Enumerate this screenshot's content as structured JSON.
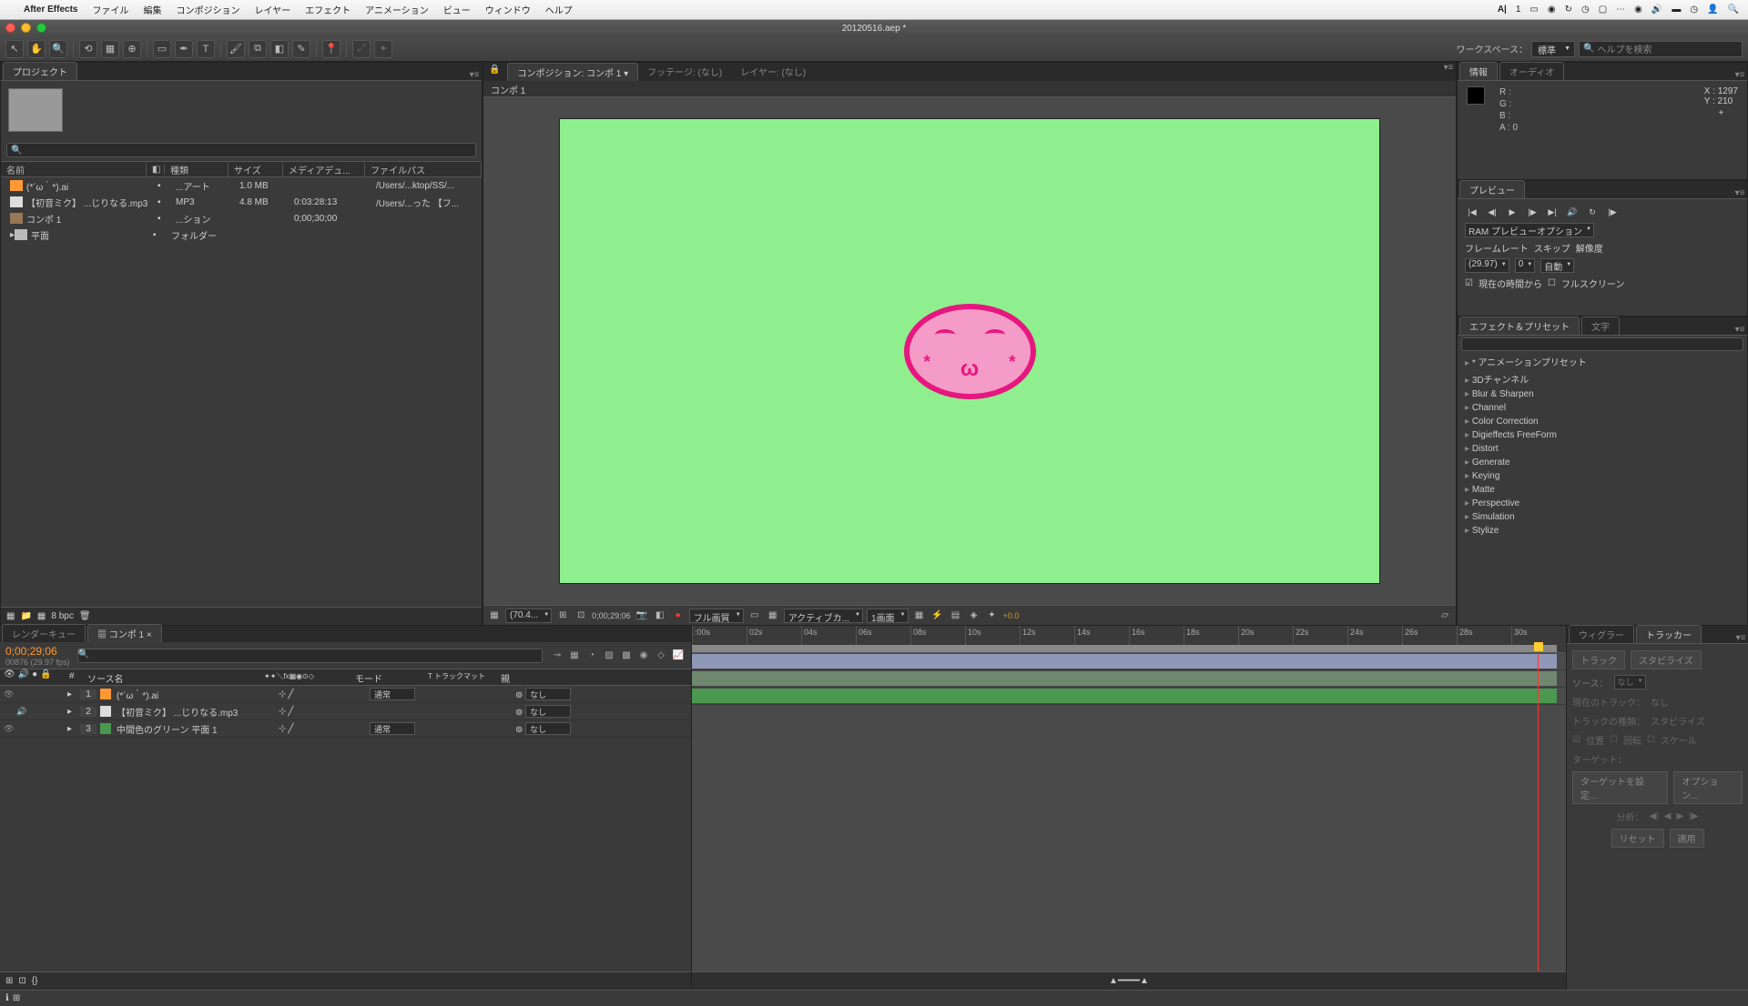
{
  "menubar": {
    "app": "After Effects",
    "items": [
      "ファイル",
      "編集",
      "コンポジション",
      "レイヤー",
      "エフェクト",
      "アニメーション",
      "ビュー",
      "ウィンドウ",
      "ヘルプ"
    ],
    "right_badge": "1"
  },
  "window_title": "20120516.aep *",
  "workspace": {
    "label": "ワークスペース：",
    "value": "標準"
  },
  "search_placeholder": "ヘルプを検索",
  "project": {
    "tab": "プロジェクト",
    "cols": {
      "name": "名前",
      "type": "種類",
      "size": "サイズ",
      "dur": "メディアデュ...",
      "path": "ファイルパス"
    },
    "items": [
      {
        "name": "(*´ω｀*).ai",
        "type": "...アート",
        "size": "1.0 MB",
        "dur": "",
        "path": "/Users/...ktop/SS/..."
      },
      {
        "name": "【初音ミク】 ...じりなる.mp3",
        "type": "MP3",
        "size": "4.8 MB",
        "dur": "0:03:28:13",
        "path": "/Users/...った 【フ..."
      },
      {
        "name": "コンポ 1",
        "type": "...ション",
        "size": "",
        "dur": "0;00;30;00",
        "path": ""
      },
      {
        "name": "平面",
        "type": "フォルダー",
        "size": "",
        "dur": "",
        "path": ""
      }
    ],
    "bpc": "8 bpc"
  },
  "comp": {
    "title": "コンポジション: コンポ 1",
    "footage": "フッテージ: (なし)",
    "layer": "レイヤー: (なし)",
    "sub": "コンポ 1",
    "footer": {
      "zoom": "(70.4...",
      "time": "0;00;29;06",
      "res": "フル画質",
      "view": "アクティブカ...",
      "grid": "1画面",
      "exp": "+0.0"
    }
  },
  "info": {
    "tab1": "情報",
    "tab2": "オーディオ",
    "r": "R :",
    "g": "G :",
    "b": "B :",
    "a": "A : 0",
    "x": "X : 1297",
    "y": "Y : 210"
  },
  "preview": {
    "tab": "プレビュー",
    "ram": "RAM プレビューオプション",
    "labels": {
      "fr": "フレームレート",
      "skip": "スキップ",
      "res": "解像度"
    },
    "fps": "(29.97)",
    "skip": "0",
    "res": "自動",
    "check1": "現在の時間から",
    "check2": "フルスクリーン"
  },
  "effects": {
    "tab1": "エフェクト＆プリセット",
    "tab2": "文字",
    "cats": [
      "* アニメーションプリセット",
      "3Dチャンネル",
      "Blur & Sharpen",
      "Channel",
      "Color Correction",
      "Digieffects FreeForm",
      "Distort",
      "Generate",
      "Keying",
      "Matte",
      "Perspective",
      "Simulation",
      "Stylize"
    ]
  },
  "timeline": {
    "tab_rq": "レンダーキュー",
    "tab_comp": "コンポ 1",
    "time": "0;00;29;06",
    "sub": "00876 (29.97 fps)",
    "col_src": "ソース名",
    "col_mode": "モード",
    "col_trk": "T トラックマット",
    "col_par": "親",
    "layers": [
      {
        "idx": "1",
        "name": "(*´ω｀*).ai",
        "mode": "通常",
        "parent": "なし",
        "color": "#ff9933"
      },
      {
        "idx": "2",
        "name": "【初音ミク】 ...じりなる.mp3",
        "mode": "",
        "parent": "なし",
        "color": "#66cccc"
      },
      {
        "idx": "3",
        "name": "中間色のグリーン 平面 1",
        "mode": "通常",
        "parent": "なし",
        "color": "#4a9850"
      }
    ],
    "ruler": [
      ":00s",
      "02s",
      "04s",
      "06s",
      "08s",
      "10s",
      "12s",
      "14s",
      "16s",
      "18s",
      "20s",
      "22s",
      "24s",
      "26s",
      "28s",
      "30s"
    ]
  },
  "tracker": {
    "tab1": "ウィグラー",
    "tab2": "トラッカー",
    "btn_track": "トラック",
    "btn_stab": "スタビライズ",
    "src_lbl": "ソース：",
    "src_val": "なし",
    "cur_track": "現在のトラック：",
    "cur_val": "なし",
    "track_type": "トラックの種類：",
    "type_val": "スタビライズ",
    "pos": "位置",
    "rot": "回転",
    "scale": "スケール",
    "target": "ターゲット：",
    "set_target": "ターゲットを設定...",
    "options": "オプション...",
    "analyze": "分析：",
    "reset": "リセット",
    "apply": "適用"
  }
}
